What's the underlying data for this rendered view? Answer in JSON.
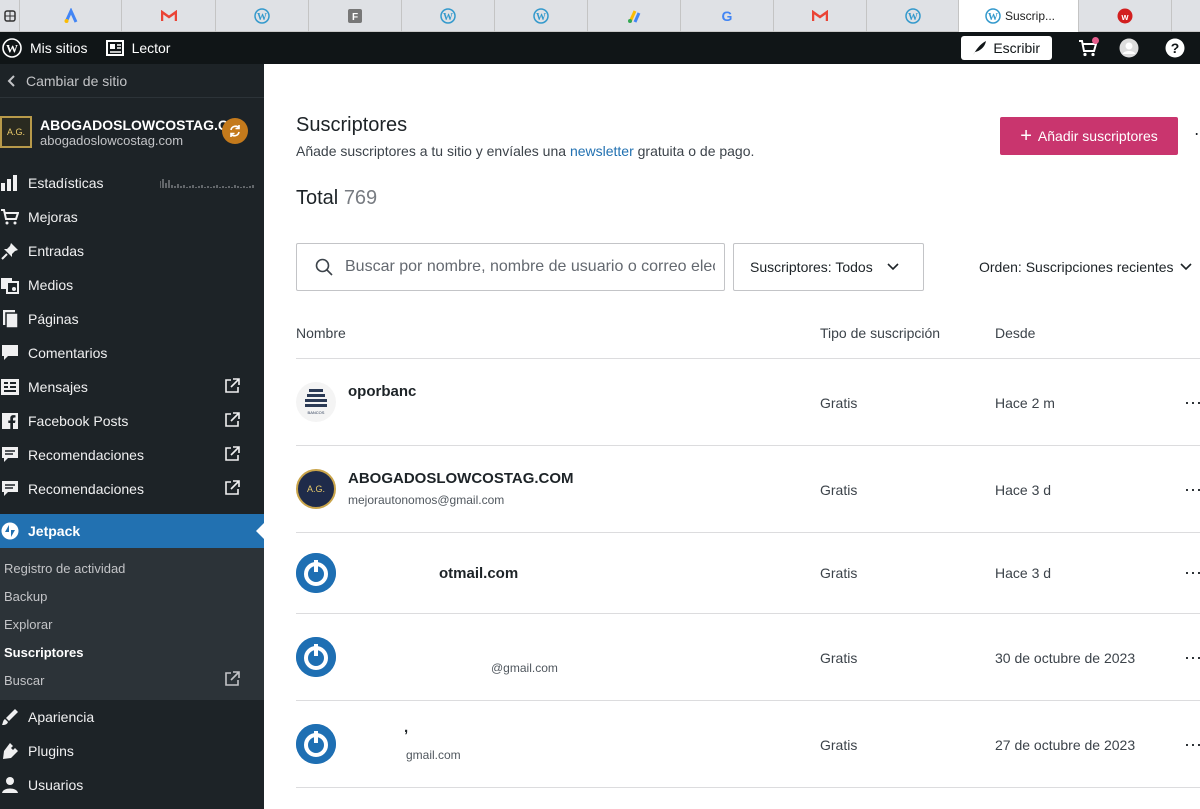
{
  "browser": {
    "tabs": [
      {
        "icon": "tab-groups-icon"
      },
      {
        "icon": "google-ads-icon"
      },
      {
        "icon": "gmail-icon"
      },
      {
        "icon": "wordpress-icon"
      },
      {
        "icon": "f-icon"
      },
      {
        "icon": "wordpress-icon"
      },
      {
        "icon": "wordpress-icon"
      },
      {
        "icon": "google-adsense-icon"
      },
      {
        "icon": "google-icon"
      },
      {
        "icon": "gmail-icon"
      },
      {
        "icon": "wordpress-icon"
      },
      {
        "icon": "wordpress-icon",
        "title": "Suscrip...",
        "active": true
      },
      {
        "icon": "red-w-icon"
      }
    ]
  },
  "adminbar": {
    "my_sites": "Mis sitios",
    "reader": "Lector",
    "write": "Escribir"
  },
  "sidebar": {
    "switch_site": "Cambiar de sitio",
    "site_name": "ABOGADOSLOWCOSTAG.COM",
    "site_url": "abogadoslowcostag.com",
    "menu": [
      {
        "label": "Estadísticas",
        "icon": "stats-icon"
      },
      {
        "label": "Mejoras",
        "icon": "cart-icon"
      },
      {
        "label": "Entradas",
        "icon": "pin-icon"
      },
      {
        "label": "Medios",
        "icon": "media-icon"
      },
      {
        "label": "Páginas",
        "icon": "pages-icon"
      },
      {
        "label": "Comentarios",
        "icon": "comment-icon"
      },
      {
        "label": "Mensajes",
        "icon": "feedback-icon",
        "external": true
      },
      {
        "label": "Facebook Posts",
        "icon": "facebook-icon",
        "external": true
      },
      {
        "label": "Recomendaciones",
        "icon": "testimonial-icon",
        "external": true
      },
      {
        "label": "Recomendaciones",
        "icon": "testimonial-icon",
        "external": true
      }
    ],
    "jetpack": "Jetpack",
    "jetpack_sub": [
      {
        "label": "Registro de actividad"
      },
      {
        "label": "Backup"
      },
      {
        "label": "Explorar"
      },
      {
        "label": "Suscriptores",
        "current": true
      },
      {
        "label": "Buscar",
        "external": true
      }
    ],
    "bottom_menu": [
      {
        "label": "Apariencia",
        "icon": "appearance-icon"
      },
      {
        "label": "Plugins",
        "icon": "plugins-icon"
      },
      {
        "label": "Usuarios",
        "icon": "users-icon"
      }
    ]
  },
  "main": {
    "title": "Suscriptores",
    "subtitle_pre": "Añade suscriptores a tu sitio y envíales una ",
    "subtitle_link": "newsletter",
    "subtitle_post": " gratuita o de pago.",
    "add_button": "Añadir suscriptores",
    "total_label": "Total",
    "total_count": "769",
    "search_placeholder": "Buscar por nombre, nombre de usuario o correo electrónico",
    "filter": "Suscriptores: Todos",
    "order": "Orden: Suscripciones recientes",
    "columns": {
      "name": "Nombre",
      "type": "Tipo de suscripción",
      "since": "Desde"
    },
    "rows": [
      {
        "name": "oporbanc",
        "email": "",
        "type": "Gratis",
        "since": "Hace 2 m",
        "avatar": "oportunidades-bancos-logo"
      },
      {
        "name": "ABOGADOSLOWCOSTAG.COM",
        "email": "mejorautonomos@gmail.com",
        "type": "Gratis",
        "since": "Hace 3 d",
        "avatar": "site-logo"
      },
      {
        "name": "otmail.com",
        "email": "",
        "type": "Gratis",
        "since": "Hace 3 d",
        "avatar": "gravatar-icon"
      },
      {
        "name": "",
        "email": "@gmail.com",
        "type": "Gratis",
        "since": "30 de octubre de 2023",
        "avatar": "gravatar-icon"
      },
      {
        "name": ",",
        "email": "gmail.com",
        "type": "Gratis",
        "since": "27 de octubre de 2023",
        "avatar": "gravatar-icon"
      }
    ]
  }
}
